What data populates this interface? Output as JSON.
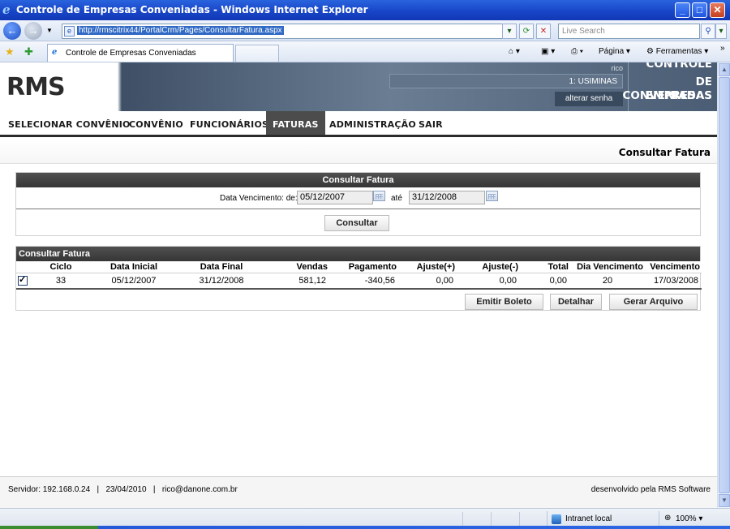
{
  "window": {
    "title": "Controle de Empresas Conveniadas - Windows Internet Explorer",
    "address": "http://rmscitrix44/PortalCrm/Pages/ConsultarFatura.aspx",
    "search_placeholder": "Live Search",
    "tab_label": "Controle de Empresas Conveniadas",
    "pagina_label": "Página",
    "ferramentas_label": "Ferramentas"
  },
  "header": {
    "logo": "RMS",
    "user_top": "rico",
    "user_company": "1: USIMINAS",
    "change_password": "alterar senha",
    "brand_line1": "CONTROLE",
    "brand_line2": "DE EMPRESAS",
    "brand_line3": "CONVENIADAS"
  },
  "menu": [
    {
      "label": "SELECIONAR CONVÊNIO",
      "active": false
    },
    {
      "label": "CONVÊNIO",
      "active": false
    },
    {
      "label": "FUNCIONÁRIOS",
      "active": false
    },
    {
      "label": "FATURAS",
      "active": true
    },
    {
      "label": "ADMINISTRAÇÃO",
      "active": false
    },
    {
      "label": "SAIR",
      "active": false
    }
  ],
  "page_title": "Consultar Fatura",
  "search_panel": {
    "title": "Consultar Fatura",
    "date_label": "Data Vencimento: de:",
    "date_from": "05/12/2007",
    "until_label": "até",
    "date_to": "31/12/2008",
    "submit_label": "Consultar"
  },
  "results": {
    "title": "Consultar Fatura",
    "columns": [
      "",
      "Ciclo",
      "Data Inicial",
      "Data Final",
      "Vendas",
      "Pagamento",
      "Ajuste(+)",
      "Ajuste(-)",
      "Total",
      "Dia Vencimento",
      "Vencimento"
    ],
    "rows": [
      {
        "checked": true,
        "ciclo": "33",
        "data_inicial": "05/12/2007",
        "data_final": "31/12/2008",
        "vendas": "581,12",
        "pagamento": "-340,56",
        "ajuste_mais": "0,00",
        "ajuste_menos": "0,00",
        "total": "0,00",
        "dia_vencimento": "20",
        "vencimento": "17/03/2008"
      }
    ],
    "actions": [
      "Emitir Boleto",
      "Detalhar",
      "Gerar Arquivo"
    ]
  },
  "footer": {
    "server": "Servidor: 192.168.0.24",
    "date": "23/04/2010",
    "email": "rico@danone.com.br",
    "credit": "desenvolvido pela RMS Software"
  },
  "statusbar": {
    "zone": "Intranet local",
    "zoom": "100%"
  },
  "colors": {
    "header_dark": "#3f5066",
    "menu_active": "#4c4c4c",
    "panel_head": "#404040",
    "titlebar": "#1846c8"
  }
}
